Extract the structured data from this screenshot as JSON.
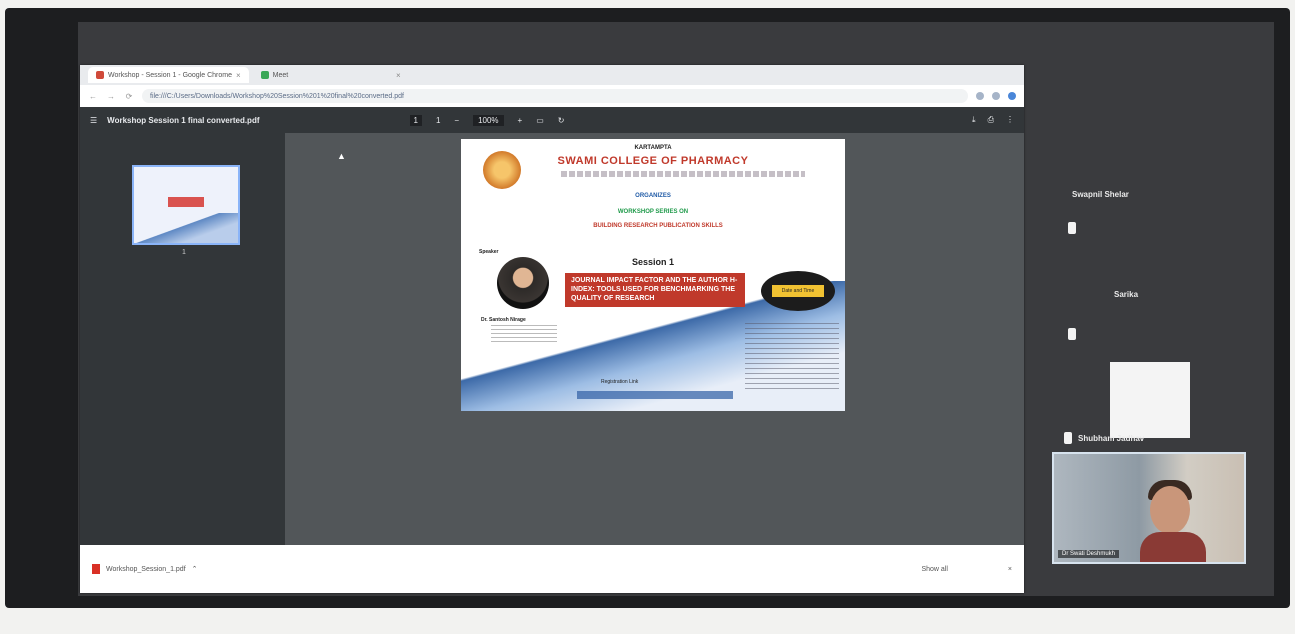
{
  "browser": {
    "tabs": [
      {
        "label": "Workshop - Session 1 - Google Chrome"
      },
      {
        "label": "Meet"
      }
    ],
    "address": "file:///C:/Users/Downloads/Workshop%20Session%201%20final%20converted.pdf"
  },
  "pdf": {
    "filename": "Workshop Session 1 final converted.pdf",
    "page_current": "1",
    "page_total": "1",
    "zoom": "100%",
    "thumbnail_number": "1"
  },
  "poster": {
    "college_top": "KARTAMPTA",
    "college": "SWAMI COLLEGE OF PHARMACY",
    "organizes": "ORGANIZES",
    "workshop": "WORKSHOP SERIES ON",
    "workshop_title": "BUILDING RESEARCH PUBLICATION SKILLS",
    "speaker_label": "Speaker",
    "session": "Session 1",
    "topic": "JOURNAL IMPACT FACTOR AND THE AUTHOR H-INDEX: TOOLS USED FOR BENCHMARKING THE QUALITY OF RESEARCH",
    "badge": "Date and Time",
    "speaker_name": "Dr. Santosh Nirage",
    "registration": "Registration Link"
  },
  "download": {
    "file": "Workshop_Session_1.pdf",
    "show_all": "Show all"
  },
  "participants": [
    {
      "name": "Swapnil Shelar"
    },
    {
      "name": "Sarika"
    },
    {
      "name": "Shubham Jadhav"
    }
  ],
  "self_video": {
    "name": "Dr Swati Deshmukh"
  }
}
